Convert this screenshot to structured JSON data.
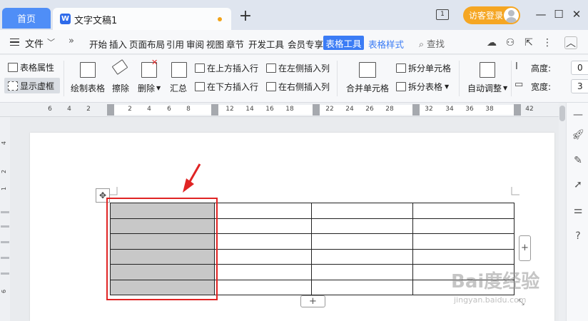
{
  "titlebar": {
    "home_tab": "首页",
    "doc_icon": "W",
    "doc_title": "文字文稿1",
    "new_tab": "+",
    "window_count": "1",
    "login_label": "访客登录",
    "minimize": "—",
    "maximize": "☐",
    "close": "✕"
  },
  "menubar": {
    "file": "文件",
    "items": [
      "开始",
      "插入",
      "页面布局",
      "引用",
      "审阅",
      "视图",
      "章节",
      "开发工具",
      "会员专享"
    ],
    "active_tab": "表格工具",
    "next_tab": "表格样式",
    "search": "查找"
  },
  "ribbon": {
    "table_props": "表格属性",
    "show_grid": "显示虚框",
    "draw_table": "绘制表格",
    "erase": "擦除",
    "delete": "删除",
    "summary": "汇总",
    "insert_row_above": "在上方插入行",
    "insert_row_below": "在下方插入行",
    "insert_col_left": "在左侧插入列",
    "insert_col_right": "在右侧插入列",
    "merge_cells": "合并单元格",
    "split_cells": "拆分单元格",
    "split_table": "拆分表格",
    "auto_fit": "自动调整",
    "height_label": "高度:",
    "height_value": "0",
    "width_label": "宽度:",
    "width_value": "3"
  },
  "ruler": {
    "ticks": [
      "6",
      "4",
      "2",
      "2",
      "4",
      "6",
      "8",
      "12",
      "14",
      "16",
      "18",
      "22",
      "24",
      "26",
      "28",
      "32",
      "34",
      "36",
      "38",
      "42"
    ]
  },
  "vruler": {
    "ticks": [
      "4",
      "2",
      "1",
      "6"
    ]
  },
  "table": {
    "rows": 6,
    "cols": 4,
    "selected_column": 1,
    "move_handle": "✥",
    "add": "+"
  },
  "watermark": {
    "main": "Bai度经验",
    "sub": "jingyan.baidu.com"
  },
  "colors": {
    "accent": "#3b7cf5",
    "home_tab": "#4f8ef7",
    "login": "#f5a623",
    "highlight_box": "#e02424",
    "selected_cells": "#c8c8c8"
  }
}
